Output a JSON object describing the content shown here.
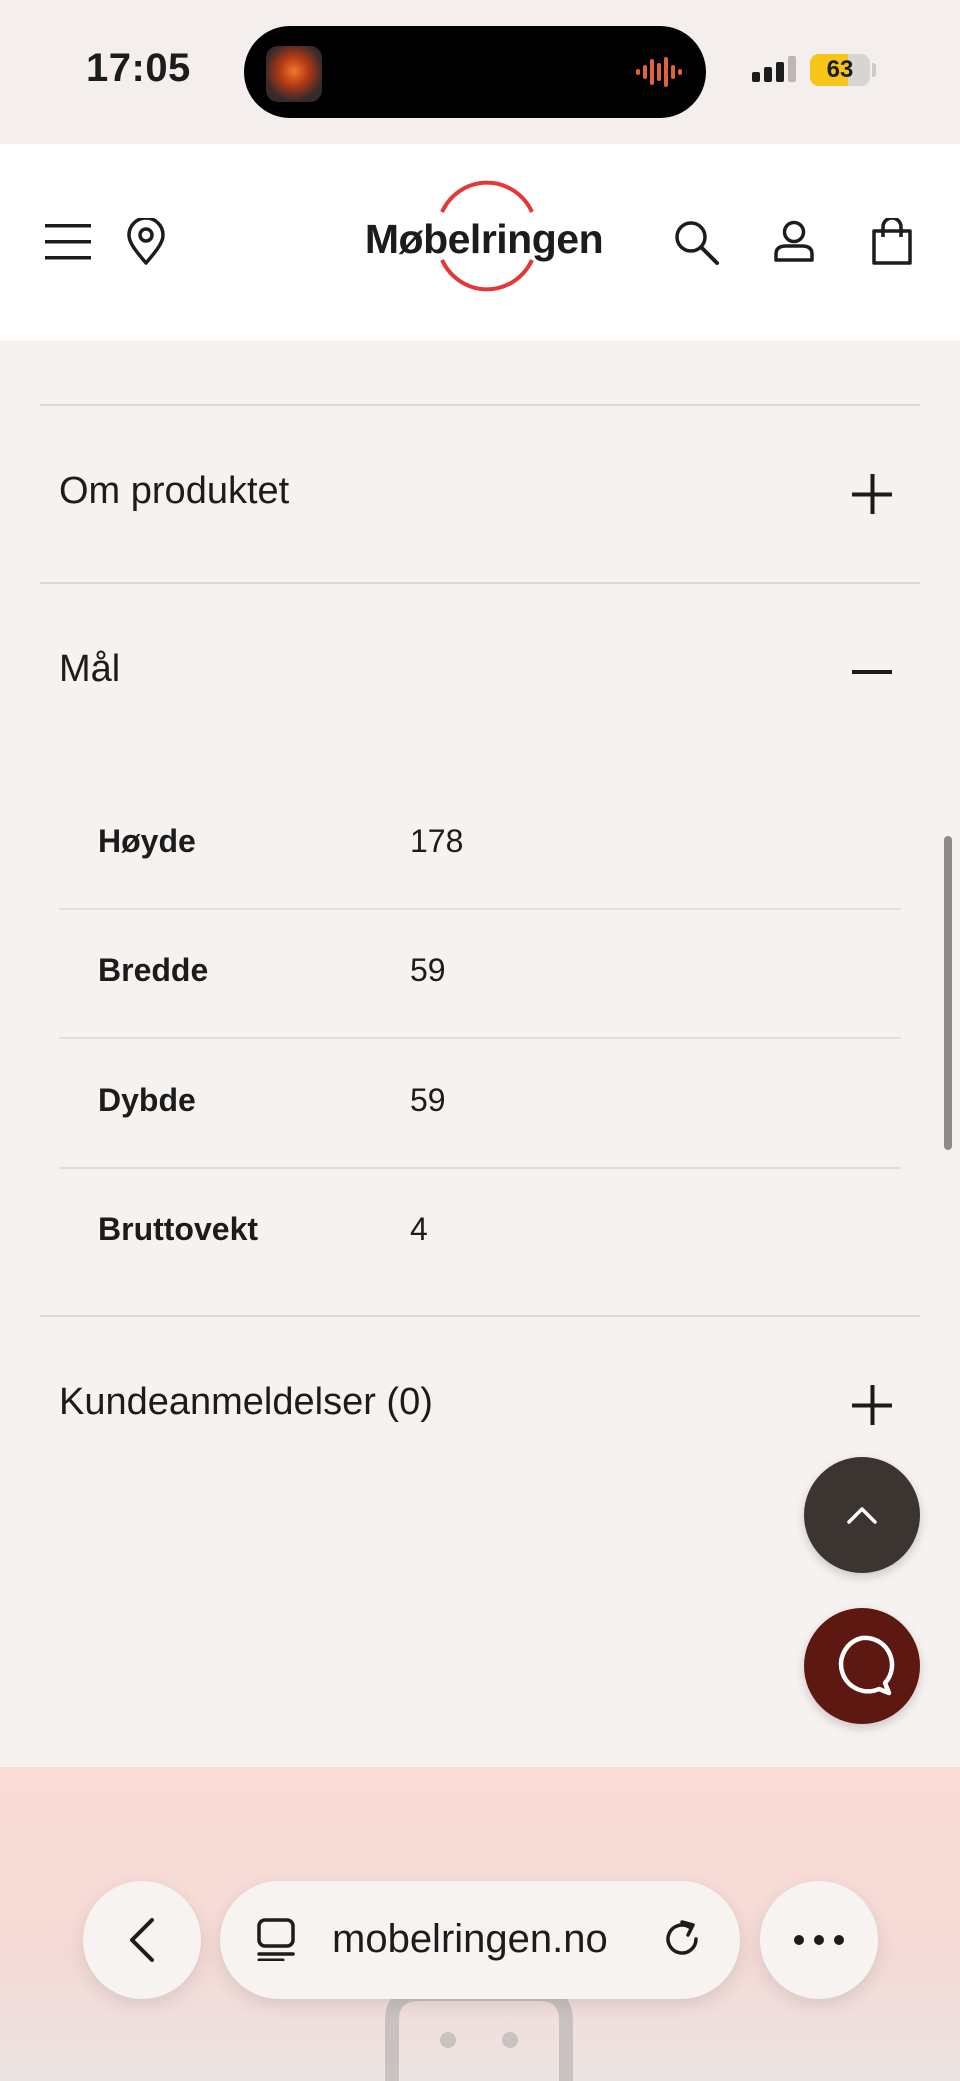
{
  "status_bar": {
    "time": "17:05",
    "battery_level": 63,
    "battery_text": "63"
  },
  "header": {
    "logo_text": "Møbelringen",
    "brand_color": "#e3373a"
  },
  "accordion": {
    "sections": [
      {
        "title": "Om produktet",
        "expanded": false
      },
      {
        "title": "Mål",
        "expanded": true
      },
      {
        "title": "Kundeanmeldelser (0)",
        "expanded": false
      }
    ],
    "specs": [
      {
        "label": "Høyde",
        "value": "178"
      },
      {
        "label": "Bredde",
        "value": "59"
      },
      {
        "label": "Dybde",
        "value": "59"
      },
      {
        "label": "Bruttovekt",
        "value": "4"
      }
    ]
  },
  "browser": {
    "url": "mobelringen.no"
  },
  "colors": {
    "page_bg": "#f6f2f0",
    "chat_button": "#5e1812",
    "scroll_top_button": "#3b3431"
  }
}
